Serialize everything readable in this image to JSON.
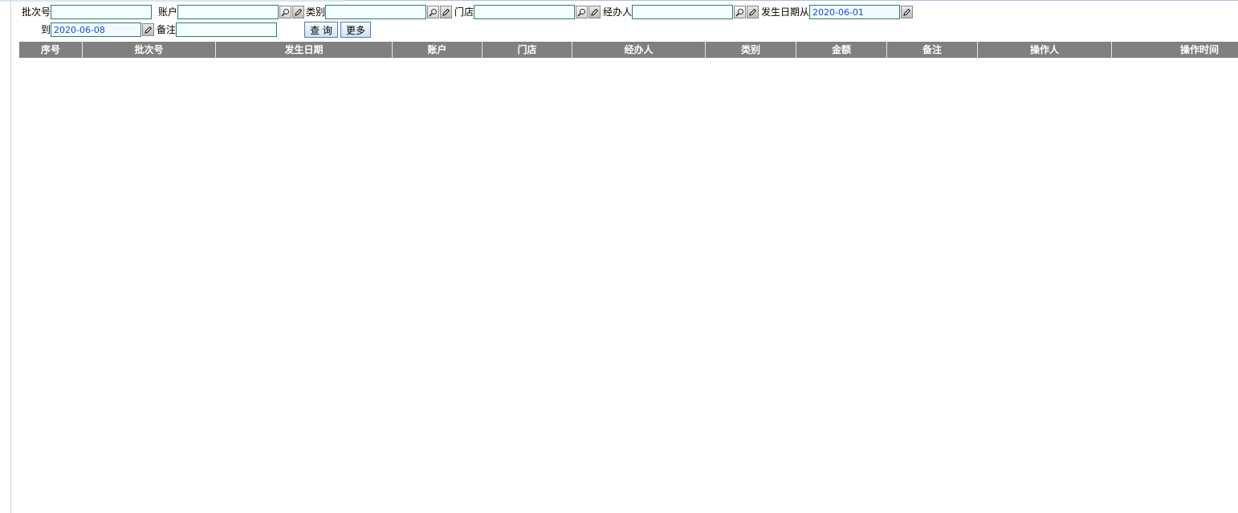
{
  "filters": {
    "batch_no_label": "批次号",
    "batch_no_value": "",
    "account_label": "账户",
    "account_value": "",
    "category_label": "类别",
    "category_value": "",
    "store_label": "门店",
    "store_value": "",
    "handler_label": "经办人",
    "handler_value": "",
    "date_from_label": "发生日期从",
    "date_from_value": "2020-06-01",
    "date_to_label": "到",
    "date_to_value": "2020-06-08",
    "remark_label": "备注",
    "remark_value": ""
  },
  "buttons": {
    "query_label": "查 询",
    "more_label": "更多"
  },
  "icons": {
    "lookup": "magnifier-icon",
    "edit": "pencil-icon"
  },
  "colors": {
    "header_bg": "#808080",
    "header_text": "#ffffff",
    "input_border": "#2f7b6e",
    "date_text": "#1a4fbf"
  },
  "grid": {
    "columns": [
      {
        "label": "序号"
      },
      {
        "label": "批次号"
      },
      {
        "label": "发生日期"
      },
      {
        "label": "账户"
      },
      {
        "label": "门店"
      },
      {
        "label": "经办人"
      },
      {
        "label": "类别"
      },
      {
        "label": "金额"
      },
      {
        "label": "备注"
      },
      {
        "label": "操作人"
      },
      {
        "label": "操作时间"
      }
    ],
    "rows": []
  }
}
